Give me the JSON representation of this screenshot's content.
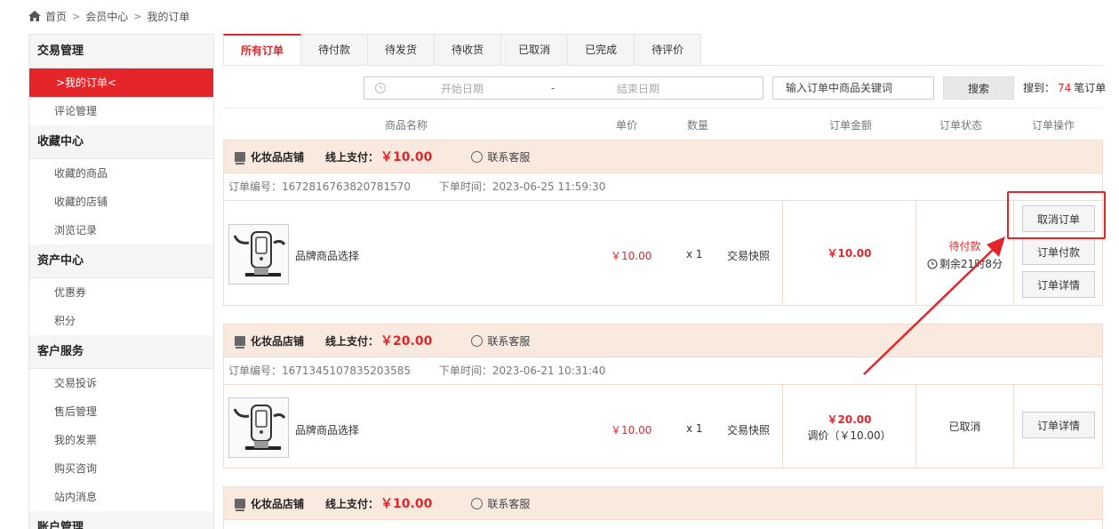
{
  "breadcrumb": {
    "items": [
      "首页",
      "会员中心",
      "我的订单"
    ],
    "separator": ">"
  },
  "sidebar": {
    "groups": [
      {
        "title": "交易管理",
        "items": [
          {
            "label": ">我的订单<",
            "active": true
          },
          {
            "label": "评论管理"
          }
        ]
      },
      {
        "title": "收藏中心",
        "items": [
          {
            "label": "收藏的商品"
          },
          {
            "label": "收藏的店铺"
          },
          {
            "label": "浏览记录"
          }
        ]
      },
      {
        "title": "资产中心",
        "items": [
          {
            "label": "优惠券"
          },
          {
            "label": "积分"
          }
        ]
      },
      {
        "title": "客户服务",
        "items": [
          {
            "label": "交易投诉"
          },
          {
            "label": "售后管理"
          },
          {
            "label": "我的发票"
          },
          {
            "label": "购买咨询"
          },
          {
            "label": "站内消息"
          }
        ]
      },
      {
        "title": "账户管理",
        "items": []
      }
    ]
  },
  "tabs": [
    "所有订单",
    "待付款",
    "待发货",
    "待收货",
    "已取消",
    "已完成",
    "待评价"
  ],
  "filter": {
    "start_date_placeholder": "开始日期",
    "dash": "-",
    "end_date_placeholder": "结束日期",
    "keyword_placeholder": "输入订单中商品关键词",
    "search_label": "搜索",
    "result_prefix": "搜到：",
    "result_count": "74",
    "result_suffix": "笔订单"
  },
  "columns": {
    "product": "商品名称",
    "unit_price": "单价",
    "quantity": "数量",
    "amount": "订单金额",
    "status": "订单状态",
    "actions": "订单操作"
  },
  "orders": [
    {
      "shop": "化妆品店铺",
      "pay_label": "线上支付：",
      "pay_amount": "￥10.00",
      "cs_label": "联系客服",
      "order_no": "订单编号：1672816763820781570",
      "order_time": "下单时间：2023-06-25 11:59:30",
      "product_name": "品牌商品选择",
      "price": "￥10.00",
      "qty": "x 1",
      "snapshot": "交易快照",
      "total": "￥10.00",
      "status": "待付款",
      "status_color": "#e4252a",
      "countdown": "剩余21时8分",
      "actions": [
        "取消订单",
        "订单付款",
        "订单详情"
      ]
    },
    {
      "shop": "化妆品店铺",
      "pay_label": "线上支付：",
      "pay_amount": "￥20.00",
      "cs_label": "联系客服",
      "order_no": "订单编号：1671345107835203585",
      "order_time": "下单时间：2023-06-21 10:31:40",
      "product_name": "品牌商品选择",
      "price": "￥10.00",
      "qty": "x 1",
      "snapshot": "交易快照",
      "total": "￥20.00",
      "adjust": "调价（￥10.00）",
      "status": "已取消",
      "status_color": "#333333",
      "actions": [
        "订单详情"
      ]
    },
    {
      "shop": "化妆品店铺",
      "pay_label": "线上支付：",
      "pay_amount": "￥10.00",
      "cs_label": "联系客服"
    }
  ],
  "colors": {
    "accent": "#e4252a",
    "shop_bar": "#f9e9df"
  }
}
